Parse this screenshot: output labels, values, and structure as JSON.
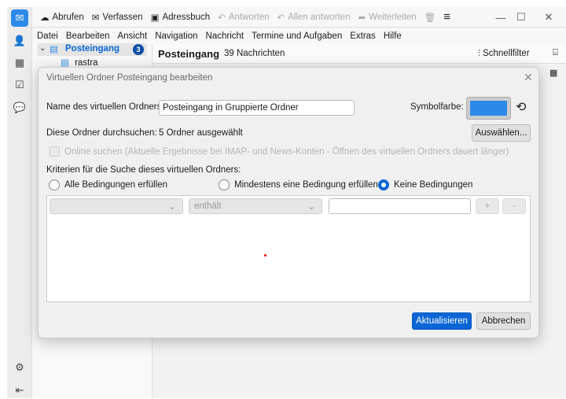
{
  "toolbar": {
    "fetch": "Abrufen",
    "compose": "Verfassen",
    "addressbook": "Adressbuch",
    "reply": "Antworten",
    "reply_all": "Allen antworten",
    "forward": "Weiterleiten"
  },
  "menu": [
    "Datei",
    "Bearbeiten",
    "Ansicht",
    "Navigation",
    "Nachricht",
    "Termine und Aufgaben",
    "Extras",
    "Hilfe"
  ],
  "folders": {
    "inbox": "Posteingang",
    "inbox_unread": "3",
    "sub": "rastra"
  },
  "thread": {
    "title": "Posteingang",
    "count": "39 Nachrichten",
    "quickfilter": "Schnellfilter"
  },
  "dialog": {
    "title": "Virtuellen Ordner Posteingang bearbeiten",
    "name_label": "Name des virtuellen Ordners:",
    "name_value": "Posteingang in Gruppierte Ordner",
    "color_label": "Symbolfarbe:",
    "color": "#2b8ae8",
    "search_label": "Diese Ordner durchsuchen:",
    "search_value": "5 Ordner ausgewählt",
    "select_button": "Auswählen...",
    "online_label": "Online suchen (Aktuelle Ergebnisse bei IMAP- und News-Konten - Öffnen des virtuellen Ordners dauert länger)",
    "criteria_label": "Kriterien für die Suche dieses virtuellen Ordners:",
    "radio_all": "Alle Bedingungen erfüllen",
    "radio_any": "Mindestens eine Bedingung erfüllen",
    "radio_none": "Keine Bedingungen",
    "operator": "enthält",
    "plus": "+",
    "minus": "-",
    "update": "Aktualisieren",
    "cancel": "Abbrechen"
  },
  "accent": "#0a66d6"
}
